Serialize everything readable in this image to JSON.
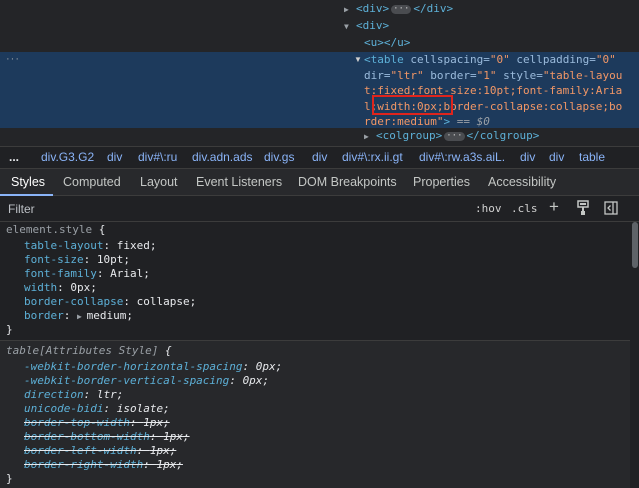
{
  "tree": {
    "line1": {
      "open": "<div>",
      "close": "</div>"
    },
    "line2": {
      "open": "<div>"
    },
    "line3": {
      "open": "<u>",
      "close": "</u>"
    },
    "selected": {
      "tag_open": "<table",
      "attr1": "cellspacing",
      "val1": "\"0\"",
      "attr2": "cellpadding",
      "val2": "\"0\"",
      "attr3": "dir",
      "val3": "\"ltr\"",
      "attr4": "border",
      "val4": "\"1\"",
      "attr5": "style",
      "val5": "\"table-layout:fixed;font-size:10pt;font-family:Arial;width:0px;border-collapse:collapse;border:medium\"",
      "tag_end": ">",
      "marker": "== $0"
    },
    "line_colgroup": {
      "open": "<colgroup>",
      "close": "</colgroup>"
    }
  },
  "breadcrumbs": [
    "div.G3.G2",
    "div",
    "div#\\:ru",
    "div.adn.ads",
    "div.gs",
    "div",
    "div#\\:rx.ii.gt",
    "div#\\:rw.a3s.aiL.",
    "div",
    "div",
    "table"
  ],
  "tabs": [
    "Styles",
    "Computed",
    "Layout",
    "Event Listeners",
    "DOM Breakpoints",
    "Properties",
    "Accessibility"
  ],
  "filter": {
    "placeholder": "Filter",
    "hov": ":hov",
    "cls": ".cls",
    "plus": "+"
  },
  "element_style": {
    "selector": "element.style",
    "props": [
      {
        "name": "table-layout",
        "value": "fixed"
      },
      {
        "name": "font-size",
        "value": "10pt"
      },
      {
        "name": "font-family",
        "value": "Arial"
      },
      {
        "name": "width",
        "value": "0px"
      },
      {
        "name": "border-collapse",
        "value": "collapse"
      },
      {
        "name": "border",
        "value": "medium"
      }
    ]
  },
  "attr_style": {
    "selector": "table[Attributes Style]",
    "props": [
      {
        "name": "-webkit-border-horizontal-spacing",
        "value": "0px"
      },
      {
        "name": "-webkit-border-vertical-spacing",
        "value": "0px"
      },
      {
        "name": "direction",
        "value": "ltr"
      },
      {
        "name": "unicode-bidi",
        "value": "isolate"
      },
      {
        "name": "border-top-width",
        "value": "1px"
      },
      {
        "name": "border-bottom-width",
        "value": "1px"
      },
      {
        "name": "border-left-width",
        "value": "1px"
      },
      {
        "name": "border-right-width",
        "value": "1px"
      }
    ]
  },
  "colors": {
    "accent": "#8ab4f8",
    "selection": "#1d3a5c",
    "highlight_box": "#e0241c"
  }
}
